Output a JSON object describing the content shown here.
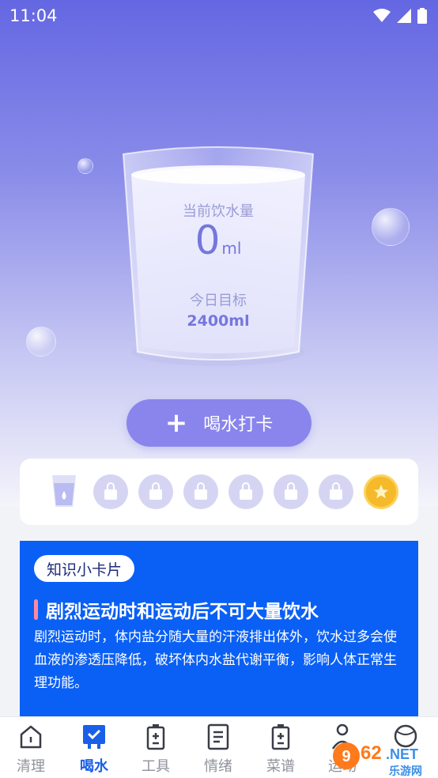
{
  "status_bar": {
    "time": "11:04"
  },
  "cup": {
    "current_label": "当前饮水量",
    "current_value": "0",
    "current_unit": "ml",
    "goal_label": "今日目标",
    "goal_value": "2400ml"
  },
  "checkin_button": {
    "label": "喝水打卡",
    "icon": "plus-icon"
  },
  "progress": {
    "completed_slots": 1,
    "locked_slots": 6,
    "reward": "star-coin-icon"
  },
  "knowledge_card": {
    "chip": "知识小卡片",
    "title": "剧烈运动时和运动后不可大量饮水",
    "body": "剧烈运动时，体内盐分随大量的汗液排出体外，饮水过多会使血液的渗透压降低，破坏体内水盐代谢平衡，影响人体正常生理功能。"
  },
  "tabs": [
    {
      "label": "清理",
      "icon": "home-icon",
      "active": false
    },
    {
      "label": "喝水",
      "icon": "water-check-icon",
      "active": true
    },
    {
      "label": "工具",
      "icon": "battery-plus-icon",
      "active": false
    },
    {
      "label": "情绪",
      "icon": "note-icon",
      "active": false
    },
    {
      "label": "菜谱",
      "icon": "battery-plus-icon",
      "active": false
    },
    {
      "label": "运动",
      "icon": "person-icon",
      "active": false
    },
    {
      "label": "",
      "icon": "ball-icon",
      "active": false
    }
  ],
  "watermark": {
    "text": "962.NET",
    "subtext": "乐游网"
  },
  "colors": {
    "accent": "#1a5fe8",
    "button": "#8a85ec",
    "card": "#0a60f5"
  }
}
